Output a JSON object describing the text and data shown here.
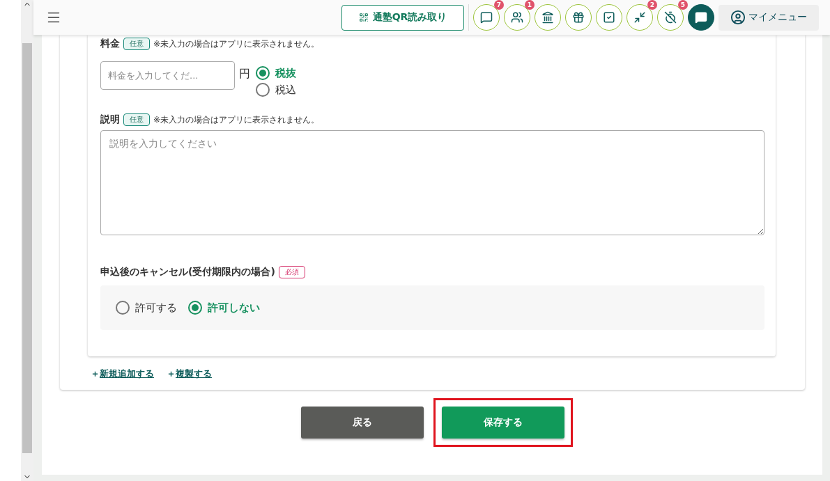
{
  "header": {
    "qr_button": "通塾QR読み取り",
    "icons": [
      {
        "kind": "chat",
        "badge": "7"
      },
      {
        "kind": "people",
        "badge": "1"
      },
      {
        "kind": "bank"
      },
      {
        "kind": "gift"
      },
      {
        "kind": "checklist"
      },
      {
        "kind": "shrink",
        "badge": "2"
      },
      {
        "kind": "timer-off",
        "badge": "5"
      },
      {
        "kind": "message-filled"
      }
    ],
    "my_menu": "マイメニュー"
  },
  "fee": {
    "label": "料金",
    "tag": {
      "kind": "optional",
      "text": "任意"
    },
    "note": "※未入力の場合はアプリに表示されません。",
    "placeholder": "料金を入力してくだ...",
    "unit": "円",
    "tax_options": [
      {
        "label": "税抜",
        "selected": true
      },
      {
        "label": "税込",
        "selected": false
      }
    ]
  },
  "description": {
    "label": "説明",
    "tag": {
      "kind": "optional",
      "text": "任意"
    },
    "note": "※未入力の場合はアプリに表示されません。",
    "placeholder": "説明を入力してください"
  },
  "cancel": {
    "label": "申込後のキャンセル(受付期限内の場合)",
    "tag": {
      "kind": "required",
      "text": "必須"
    },
    "options": [
      {
        "label": "許可する",
        "selected": false
      },
      {
        "label": "許可しない",
        "selected": true
      }
    ]
  },
  "links": [
    {
      "icon": "＋",
      "label": "新規追加する"
    },
    {
      "icon": "＋",
      "label": "複製する"
    }
  ],
  "buttons": [
    {
      "kind": "back",
      "label": "戻る",
      "highlighted": false
    },
    {
      "kind": "save",
      "label": "保存する",
      "highlighted": true
    }
  ]
}
